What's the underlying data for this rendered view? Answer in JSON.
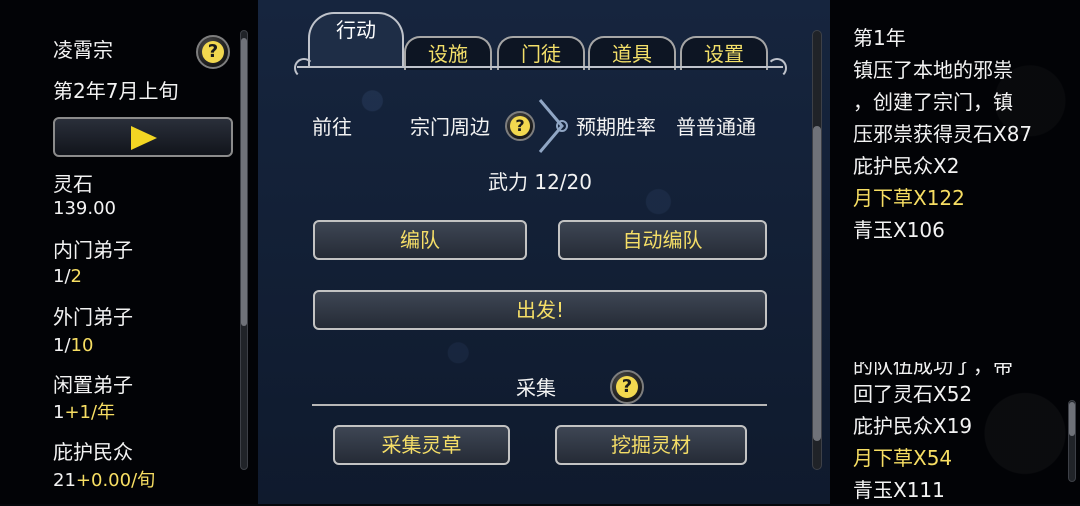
{
  "left": {
    "sect_name": "凌霄宗",
    "date": "第2年7月上旬",
    "stats": [
      {
        "label": "灵石",
        "value_white": "139.00",
        "value_yellow": ""
      },
      {
        "label": "内门弟子",
        "value_white": "1/",
        "value_yellow": "2"
      },
      {
        "label": "外门弟子",
        "value_white": "1/",
        "value_yellow": "10"
      },
      {
        "label": "闲置弟子",
        "value_white": "1",
        "value_yellow": "+1/年"
      },
      {
        "label": "庇护民众",
        "value_white": "21",
        "value_yellow": "+0.00/旬"
      }
    ]
  },
  "tabs": [
    "行动",
    "设施",
    "门徒",
    "道具",
    "设置"
  ],
  "action": {
    "go_label": "前往",
    "destination": "宗门周边",
    "expected_win_label": "预期胜率",
    "expected_win_value": "普普通通",
    "force": "武力 12/20",
    "formation_button": "编队",
    "auto_formation_button": "自动编队",
    "depart_button": "出发!",
    "gather_label": "采集",
    "gather_herb_button": "采集灵草",
    "mine_button": "挖掘灵材"
  },
  "log": {
    "top": [
      {
        "text": "第1年",
        "color": "white"
      },
      {
        "text": "镇压了本地的邪祟",
        "color": "white"
      },
      {
        "text": "，创建了宗门，镇",
        "color": "white"
      },
      {
        "text": "压邪祟获得灵石X87",
        "color": "white"
      },
      {
        "text": "庇护民众X2",
        "color": "white"
      },
      {
        "text": "月下草X122",
        "color": "yellow"
      },
      {
        "text": "青玉X106",
        "color": "white"
      }
    ],
    "bottom": [
      {
        "text": "的队伍成功了，带",
        "color": "white"
      },
      {
        "text": "回了灵石X52",
        "color": "white"
      },
      {
        "text": "庇护民众X19",
        "color": "white"
      },
      {
        "text": "月下草X54",
        "color": "yellow"
      },
      {
        "text": "青玉X111",
        "color": "white"
      }
    ]
  },
  "colors": {
    "accent_yellow": "#f7de63",
    "panel_blue": "#16253e"
  }
}
